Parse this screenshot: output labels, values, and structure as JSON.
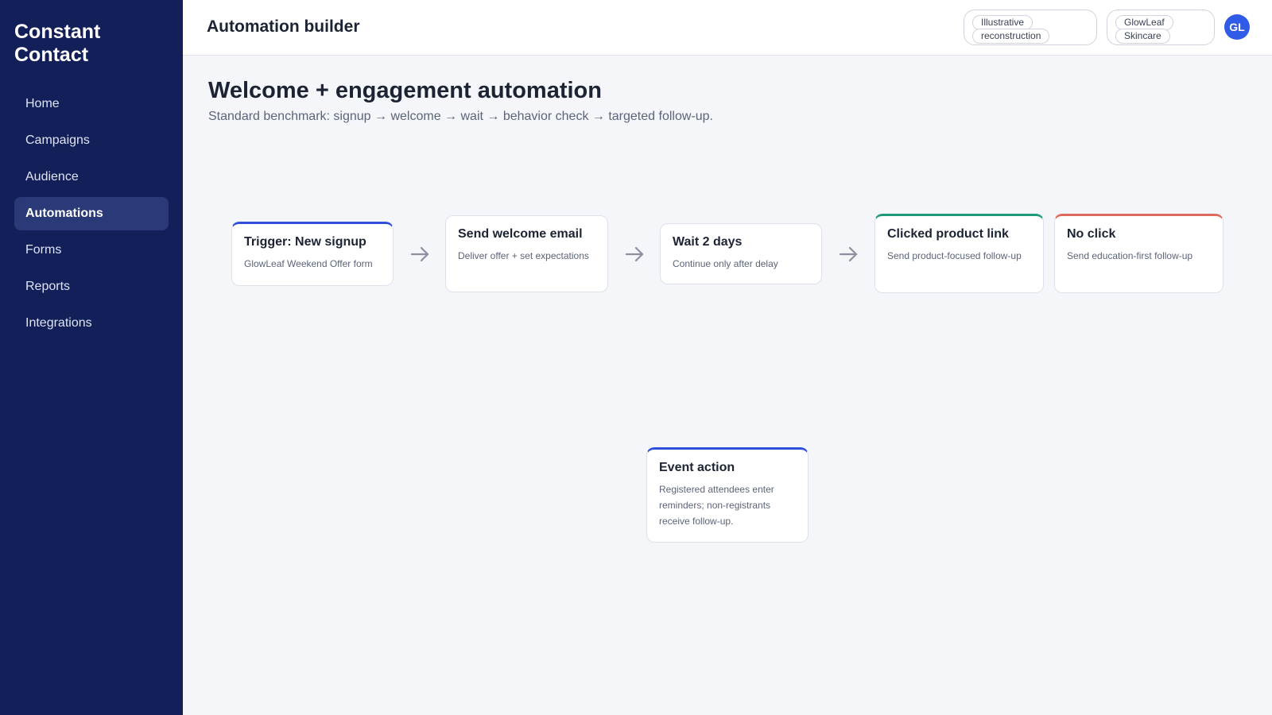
{
  "sidebar": {
    "brand": "Constant Contact",
    "items": [
      {
        "label": "Home",
        "active": false
      },
      {
        "label": "Campaigns",
        "active": false
      },
      {
        "label": "Audience",
        "active": false
      },
      {
        "label": "Automations",
        "active": true
      },
      {
        "label": "Forms",
        "active": false
      },
      {
        "label": "Reports",
        "active": false
      },
      {
        "label": "Integrations",
        "active": false
      }
    ]
  },
  "header": {
    "title": "Automation builder",
    "badges": [
      {
        "line1": "Illustrative",
        "line2": "reconstruction"
      },
      {
        "line1": "GlowLeaf",
        "line2": "Skincare"
      }
    ],
    "avatar_initials": "GL"
  },
  "page": {
    "title": "Welcome + engagement automation",
    "subtitle": "Standard benchmark: signup → welcome → wait → behavior check → targeted follow-up."
  },
  "flow": {
    "steps": [
      {
        "title": "Trigger: New signup",
        "desc": "GlowLeaf Weekend Offer form",
        "accent": "#2f4fdc"
      },
      {
        "title": "Send welcome email",
        "desc": "Deliver offer + set expectations",
        "accent": ""
      },
      {
        "title": "Wait 2 days",
        "desc": "Continue only after delay",
        "accent": ""
      },
      {
        "title": "Clicked product link",
        "desc": "Send product-focused follow-up",
        "accent": "#1f9a78"
      },
      {
        "title": "No click",
        "desc": "Send education-first follow-up",
        "accent": "#de6a5f"
      }
    ],
    "event": {
      "title": "Event action",
      "desc": "Registered attendees enter reminders; non-registrants receive follow-up.",
      "accent": "#2f4fdc"
    }
  },
  "icons": {
    "arrow": "arrow-right-icon"
  }
}
